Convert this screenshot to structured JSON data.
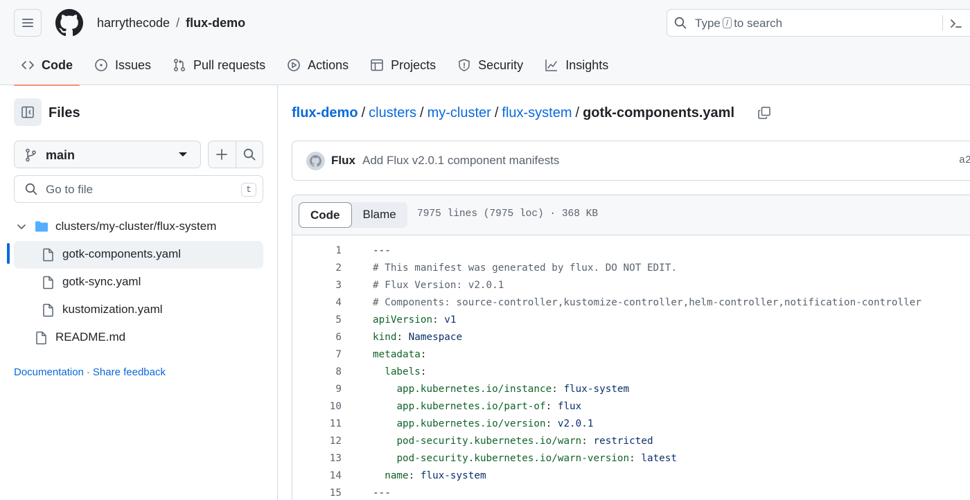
{
  "header": {
    "owner": "harrythecode",
    "separator": "/",
    "repo": "flux-demo",
    "search": {
      "before": "Type",
      "key": "/",
      "after": "to search"
    },
    "tabs": [
      {
        "label": "Code",
        "icon": "code-icon",
        "active": true
      },
      {
        "label": "Issues",
        "icon": "issue-opened-icon"
      },
      {
        "label": "Pull requests",
        "icon": "git-pull-request-icon"
      },
      {
        "label": "Actions",
        "icon": "play-icon"
      },
      {
        "label": "Projects",
        "icon": "table-icon"
      },
      {
        "label": "Security",
        "icon": "shield-icon"
      },
      {
        "label": "Insights",
        "icon": "graph-icon"
      }
    ]
  },
  "sidebar": {
    "title": "Files",
    "branch": "main",
    "goto_placeholder": "Go to file",
    "goto_key": "t",
    "tree": [
      {
        "label": "clusters/my-cluster/flux-system",
        "type": "folder",
        "expanded": true
      },
      {
        "label": "gotk-components.yaml",
        "type": "file",
        "selected": true
      },
      {
        "label": "gotk-sync.yaml",
        "type": "file"
      },
      {
        "label": "kustomization.yaml",
        "type": "file"
      },
      {
        "label": "README.md",
        "type": "file"
      }
    ],
    "links": {
      "documentation": "Documentation",
      "separator": "·",
      "feedback": "Share feedback"
    }
  },
  "main": {
    "path": [
      "flux-demo",
      "clusters",
      "my-cluster",
      "flux-system"
    ],
    "path_sep": "/",
    "file": "gotk-components.yaml",
    "commit": {
      "author": "Flux",
      "message": "Add Flux v2.0.1 component manifests",
      "sha": "a2"
    },
    "view_tabs": {
      "code": "Code",
      "blame": "Blame"
    },
    "file_info": "7975 lines (7975 loc) · 368 KB",
    "lines": [
      {
        "n": "1",
        "text": "---"
      },
      {
        "n": "2",
        "text": "# This manifest was generated by flux. DO NOT EDIT."
      },
      {
        "n": "3",
        "text": "# Flux Version: v2.0.1"
      },
      {
        "n": "4",
        "text": "# Components: source-controller,kustomize-controller,helm-controller,notification-controller"
      },
      {
        "n": "5",
        "text": "apiVersion: v1"
      },
      {
        "n": "6",
        "text": "kind: Namespace"
      },
      {
        "n": "7",
        "text": "metadata:"
      },
      {
        "n": "8",
        "text": "  labels:"
      },
      {
        "n": "9",
        "text": "    app.kubernetes.io/instance: flux-system"
      },
      {
        "n": "10",
        "text": "    app.kubernetes.io/part-of: flux"
      },
      {
        "n": "11",
        "text": "    app.kubernetes.io/version: v2.0.1"
      },
      {
        "n": "12",
        "text": "    pod-security.kubernetes.io/warn: restricted"
      },
      {
        "n": "13",
        "text": "    pod-security.kubernetes.io/warn-version: latest"
      },
      {
        "n": "14",
        "text": "  name: flux-system"
      },
      {
        "n": "15",
        "text": "---"
      }
    ]
  },
  "colors": {
    "link": "#0969da",
    "tab_underline": "#fd8c73",
    "yaml_key": "#116329",
    "yaml_value": "#0a3069",
    "comment": "#59636e"
  }
}
